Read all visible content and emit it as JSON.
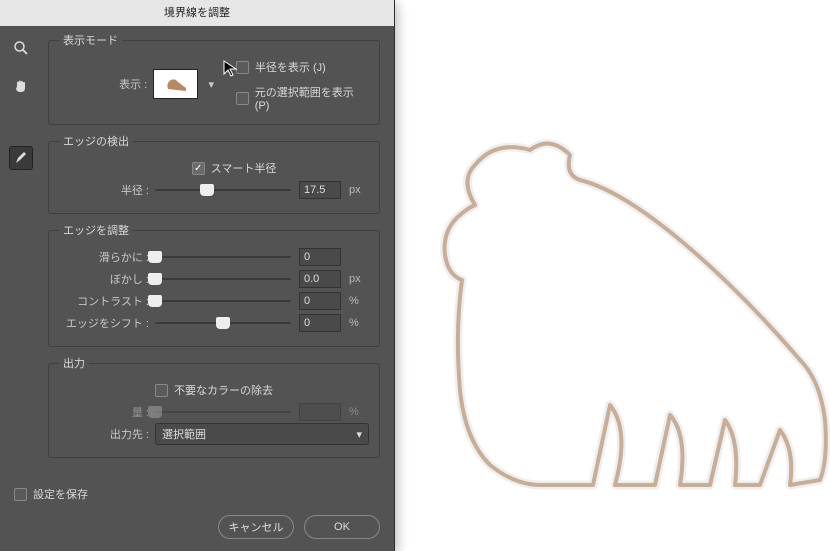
{
  "dialog": {
    "title": "境界線を調整",
    "viewMode": {
      "legend": "表示モード",
      "showLabel": "表示 :",
      "showRadius": {
        "label": "半径を表示 (J)",
        "checked": false
      },
      "showOriginal": {
        "label": "元の選択範囲を表示 (P)",
        "checked": false
      }
    },
    "edgeDetect": {
      "legend": "エッジの検出",
      "smartRadius": {
        "label": "スマート半径",
        "checked": true
      },
      "radius": {
        "label": "半径 :",
        "value": "17.5",
        "unit": "px",
        "pos": 38
      }
    },
    "edgeAdjust": {
      "legend": "エッジを調整",
      "smooth": {
        "label": "滑らかに :",
        "value": "0",
        "unit": "",
        "pos": 0
      },
      "feather": {
        "label": "ぼかし :",
        "value": "0.0",
        "unit": "px",
        "pos": 0
      },
      "contrast": {
        "label": "コントラスト :",
        "value": "0",
        "unit": "%",
        "pos": 0
      },
      "shift": {
        "label": "エッジをシフト :",
        "value": "0",
        "unit": "%",
        "pos": 50
      }
    },
    "output": {
      "legend": "出力",
      "decontaminate": {
        "label": "不要なカラーの除去",
        "checked": false
      },
      "amount": {
        "label": "量 :",
        "value": "",
        "unit": "%",
        "pos": 0
      },
      "outputTo": {
        "label": "出力先 :",
        "value": "選択範囲"
      }
    },
    "remember": {
      "label": "設定を保存",
      "checked": false
    },
    "buttons": {
      "cancel": "キャンセル",
      "ok": "OK"
    }
  }
}
